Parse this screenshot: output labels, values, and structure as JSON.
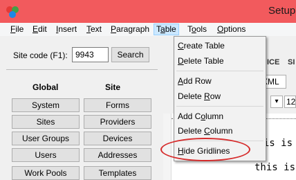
{
  "window": {
    "title": "Setup",
    "title_bar_color": "#f25a5d"
  },
  "menubar": {
    "items": [
      {
        "label": "File",
        "accel": "F"
      },
      {
        "label": "Edit",
        "accel": "E"
      },
      {
        "label": "Insert",
        "accel": "I"
      },
      {
        "label": "Text",
        "accel": "T"
      },
      {
        "label": "Paragraph",
        "accel": "P"
      },
      {
        "label": "Table",
        "accel": "a",
        "active": true
      },
      {
        "label": "Tools",
        "accel": "o"
      },
      {
        "label": "Options",
        "accel": "O"
      }
    ]
  },
  "site_code": {
    "label": "Site code (F1):",
    "value": "9943",
    "search_label": "Search"
  },
  "global_column": {
    "header": "Global",
    "buttons": [
      "System",
      "Sites",
      "User Groups",
      "Users",
      "Work Pools"
    ]
  },
  "site_column": {
    "header": "Site",
    "buttons": [
      "Forms",
      "Providers",
      "Devices",
      "Addresses",
      "Templates"
    ]
  },
  "right_panel": {
    "label_fragment_1": "ICE",
    "label_fragment_2": "SI",
    "format_value": "XML",
    "size_value": "12",
    "code_line_1": "this is",
    "code_line_2": "this is"
  },
  "table_menu": {
    "items": [
      {
        "label": "Create Table",
        "accel_index": 0
      },
      {
        "label": "Delete Table",
        "accel_index": 0
      },
      {
        "label": "Add Row",
        "accel_index": 0
      },
      {
        "label": "Delete Row",
        "accel_index": 7
      },
      {
        "label": "Add Column",
        "accel_index": 5
      },
      {
        "label": "Delete Column",
        "accel_index": 7
      },
      {
        "label": "Hide Gridlines",
        "accel_index": 0
      }
    ]
  },
  "annotation": {
    "color": "#d62b2b",
    "target": "Hide Gridlines"
  }
}
